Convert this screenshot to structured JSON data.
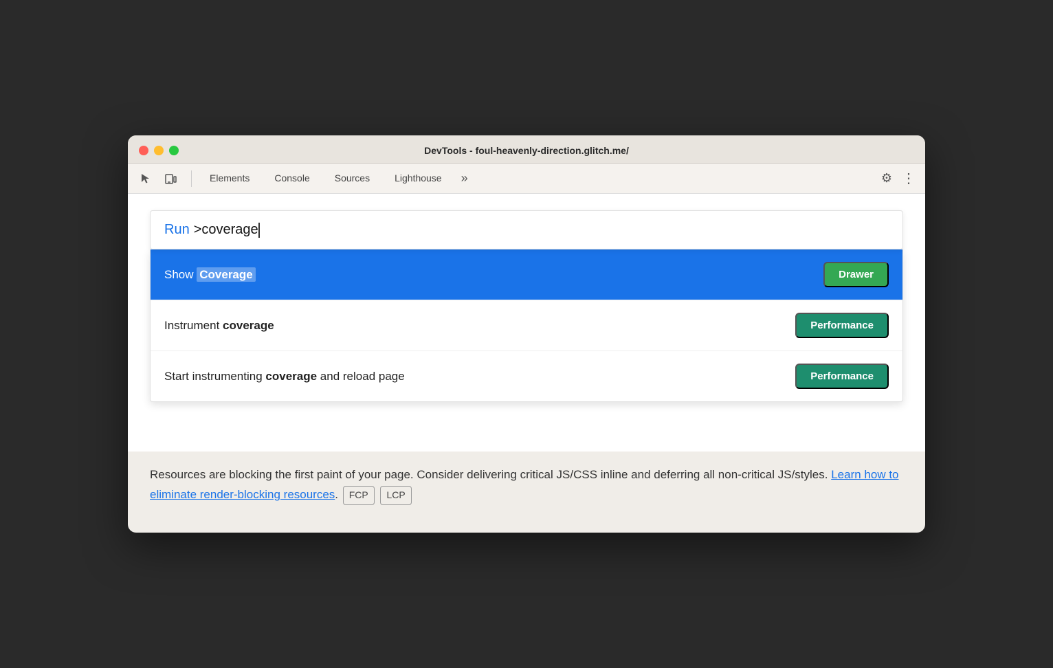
{
  "window": {
    "title": "DevTools - foul-heavenly-direction.glitch.me/"
  },
  "traffic_lights": {
    "red_label": "close",
    "orange_label": "minimize",
    "green_label": "maximize"
  },
  "tabs": {
    "items": [
      {
        "id": "elements",
        "label": "Elements"
      },
      {
        "id": "console",
        "label": "Console"
      },
      {
        "id": "sources",
        "label": "Sources"
      },
      {
        "id": "lighthouse",
        "label": "Lighthouse"
      }
    ],
    "more_label": "»",
    "gear_icon": "⚙",
    "dots_icon": "⋮"
  },
  "command_bar": {
    "run_label": "Run",
    "input_value": ">coverage"
  },
  "dropdown": {
    "items": [
      {
        "id": "show-coverage",
        "text_prefix": "Show ",
        "text_highlight": "Coverage",
        "badge_label": "Drawer",
        "highlighted": true
      },
      {
        "id": "instrument-coverage",
        "text_prefix": "Instrument ",
        "text_bold": "coverage",
        "badge_label": "Performance",
        "highlighted": false
      },
      {
        "id": "start-instrumenting",
        "text_prefix": "Start instrumenting ",
        "text_bold": "coverage",
        "text_suffix": " and reload page",
        "badge_label": "Performance",
        "highlighted": false
      }
    ]
  },
  "bottom_text": {
    "body": "Resources are blocking the first paint of your page. Consider delivering critical JS/CSS inline and deferring all non-critical JS/styles.",
    "link_text": "Learn how to eliminate render-blocking resources",
    "link_href": "#",
    "tags": [
      "FCP",
      "LCP"
    ]
  }
}
